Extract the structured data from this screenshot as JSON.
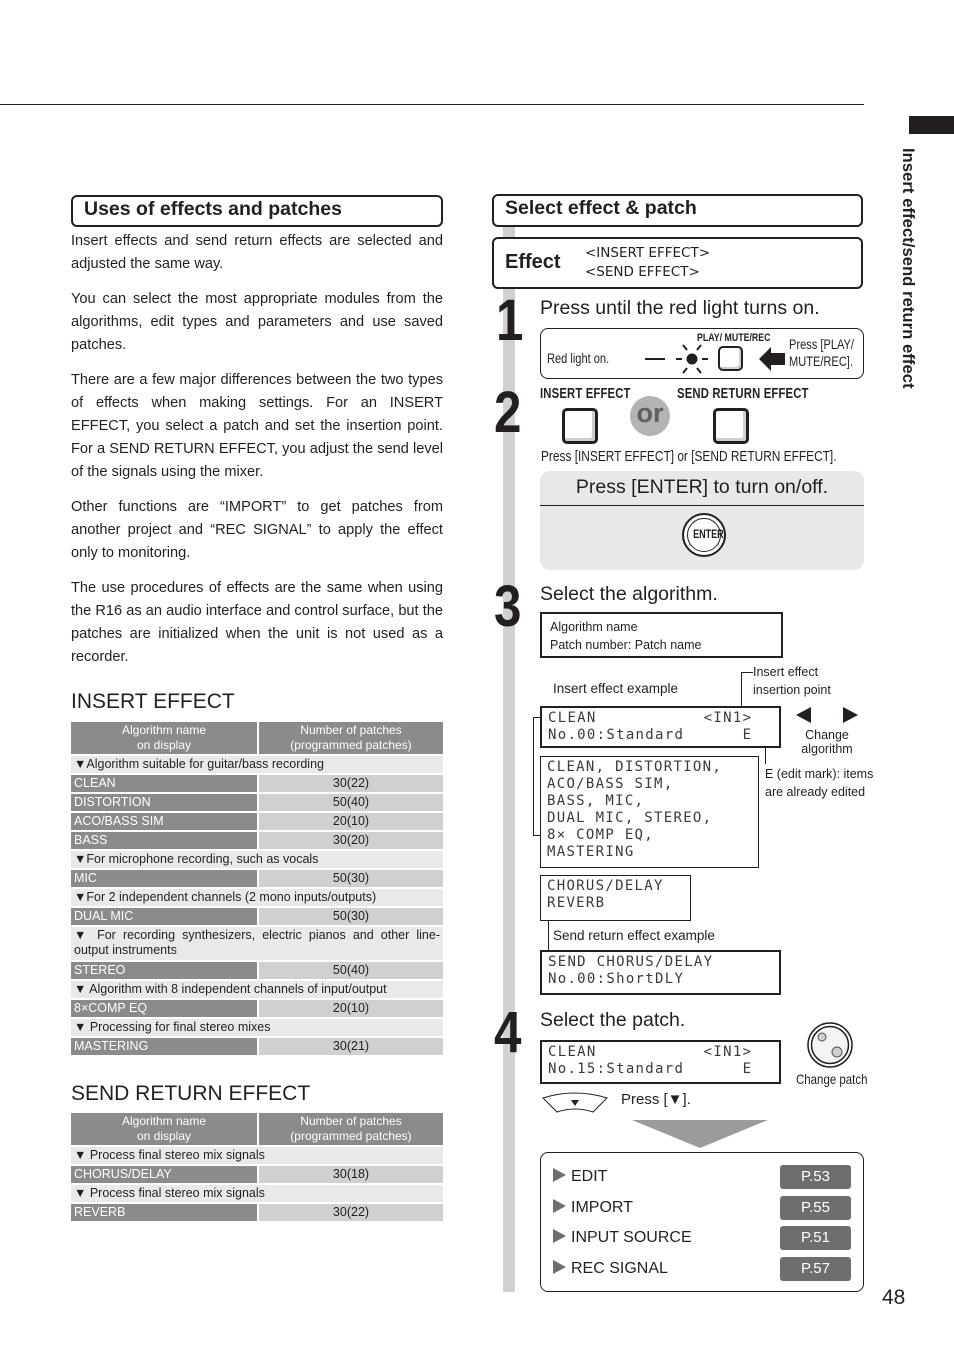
{
  "side_tab": {
    "title": "Insert effect/send return effect"
  },
  "page_number": "48",
  "left": {
    "heading": "Uses of effects and patches",
    "paragraphs": [
      "Insert effects and send return effects are selected and adjusted the same way.",
      "You can select the most appropriate modules from the algorithms, edit types and parameters and use saved patches.",
      "There are a few major differences between the two types of effects when making settings. For an INSERT EFFECT, you select a patch and set the insertion point. For a SEND RETURN EFFECT, you adjust the send level of the signals using the  mixer.",
      "Other functions are “IMPORT” to get patches from another project and “REC SIGNAL” to apply the effect only to monitoring.",
      "The use procedures of effects are the same when using the R16 as an audio interface and control surface, but the patches are initialized when the unit is not used as a recorder."
    ],
    "insert_effect": {
      "title": "INSERT EFFECT",
      "headers": [
        "Algorithm name on display",
        "Number of patches (programmed patches)"
      ],
      "header_lines": [
        [
          "Algorithm name",
          "on display"
        ],
        [
          "Number of patches",
          "(programmed patches)"
        ]
      ],
      "rows": [
        {
          "type": "category",
          "text": "▼Algorithm suitable for guitar/bass recording"
        },
        {
          "type": "algorithm",
          "name": "CLEAN",
          "patches": "30(22)"
        },
        {
          "type": "algorithm",
          "name": "DISTORTION",
          "patches": "50(40)"
        },
        {
          "type": "algorithm",
          "name": "ACO/BASS SIM",
          "patches": "20(10)"
        },
        {
          "type": "algorithm",
          "name": "BASS",
          "patches": "30(20)"
        },
        {
          "type": "category",
          "text": "▼For microphone recording, such as vocals"
        },
        {
          "type": "algorithm",
          "name": "MIC",
          "patches": "50(30)"
        },
        {
          "type": "category",
          "text": "▼For 2 independent channels (2 mono inputs/outputs)"
        },
        {
          "type": "algorithm",
          "name": "DUAL MIC",
          "patches": "50(30)"
        },
        {
          "type": "category",
          "text": "▼ For recording synthesizers, electric pianos and other line-output instruments",
          "multi": true
        },
        {
          "type": "algorithm",
          "name": "STEREO",
          "patches": "50(40)"
        },
        {
          "type": "category",
          "text": "▼ Algorithm with 8 independent channels of input/output"
        },
        {
          "type": "algorithm",
          "name": "8×COMP EQ",
          "patches": "20(10)"
        },
        {
          "type": "category",
          "text": "▼ Processing for final stereo mixes"
        },
        {
          "type": "algorithm",
          "name": "MASTERING",
          "patches": "30(21)"
        }
      ]
    },
    "send_return_effect": {
      "title": "SEND RETURN EFFECT",
      "header_lines": [
        [
          "Algorithm name",
          "on display"
        ],
        [
          "Number of patches",
          "(programmed patches)"
        ]
      ],
      "rows": [
        {
          "type": "category",
          "text": "▼ Process final stereo mix signals"
        },
        {
          "type": "algorithm",
          "name": "CHORUS/DELAY",
          "patches": "30(18)"
        },
        {
          "type": "category",
          "text": "▼ Process final stereo mix signals"
        },
        {
          "type": "algorithm",
          "name": "REVERB",
          "patches": "30(22)"
        }
      ]
    }
  },
  "right": {
    "heading": "Select effect & patch",
    "effect_label": "Effect",
    "effect_options": [
      "<INSERT EFFECT>",
      "<SEND EFFECT>"
    ],
    "steps": [
      {
        "number": "1",
        "text": "Press until the red light turns on.",
        "red_light_label": "Red light on.",
        "button_label": "PLAY/ MUTE/REC",
        "press_hint_lines": [
          "Press [PLAY/",
          "MUTE/REC]."
        ]
      },
      {
        "number": "2",
        "insert_button_label": "INSERT EFFECT",
        "or_label": "or",
        "send_button_label": "SEND RETURN EFFECT",
        "press_hint": "Press [INSERT EFFECT] or [SEND RETURN EFFECT].",
        "enter_hint": "Press [ENTER] to turn on/off.",
        "enter_button_label": "ENTER"
      },
      {
        "number": "3",
        "text": "Select the algorithm.",
        "legend_lines": [
          "Algorithm name",
          "Patch number: Patch name"
        ],
        "insert_example_label": "Insert effect example",
        "insertion_point_lines": [
          "Insert effect",
          "insertion point"
        ],
        "lcd_insert": [
          "CLEAN           <IN1>",
          "No.00:Standard      E"
        ],
        "change_algorithm_lines": [
          "Change",
          "algorithm"
        ],
        "edit_mark_lines": [
          "E (edit mark): items",
          "are already edited"
        ],
        "insert_algorithms_lcd": [
          "CLEAN, DISTORTION,",
          "ACO/BASS SIM,",
          "BASS, MIC,",
          "DUAL MIC, STEREO,",
          "8× COMP EQ,",
          "MASTERING"
        ],
        "send_algorithms_lcd": [
          "CHORUS/DELAY",
          "REVERB"
        ],
        "send_example_label": "Send return effect example",
        "lcd_send": [
          "SEND CHORUS/DELAY",
          "No.00:ShortDLY"
        ]
      },
      {
        "number": "4",
        "text": "Select the patch.",
        "lcd_patch": [
          "CLEAN           <IN1>",
          "No.15:Standard      E"
        ],
        "change_patch_label": "Change patch",
        "press_down_hint": "Press [▼]."
      }
    ],
    "related_pages": [
      {
        "label": "EDIT",
        "page": "P.53"
      },
      {
        "label": "IMPORT",
        "page": "P.55"
      },
      {
        "label": "INPUT SOURCE",
        "page": "P.51"
      },
      {
        "label": "REC SIGNAL",
        "page": "P.57"
      }
    ]
  }
}
